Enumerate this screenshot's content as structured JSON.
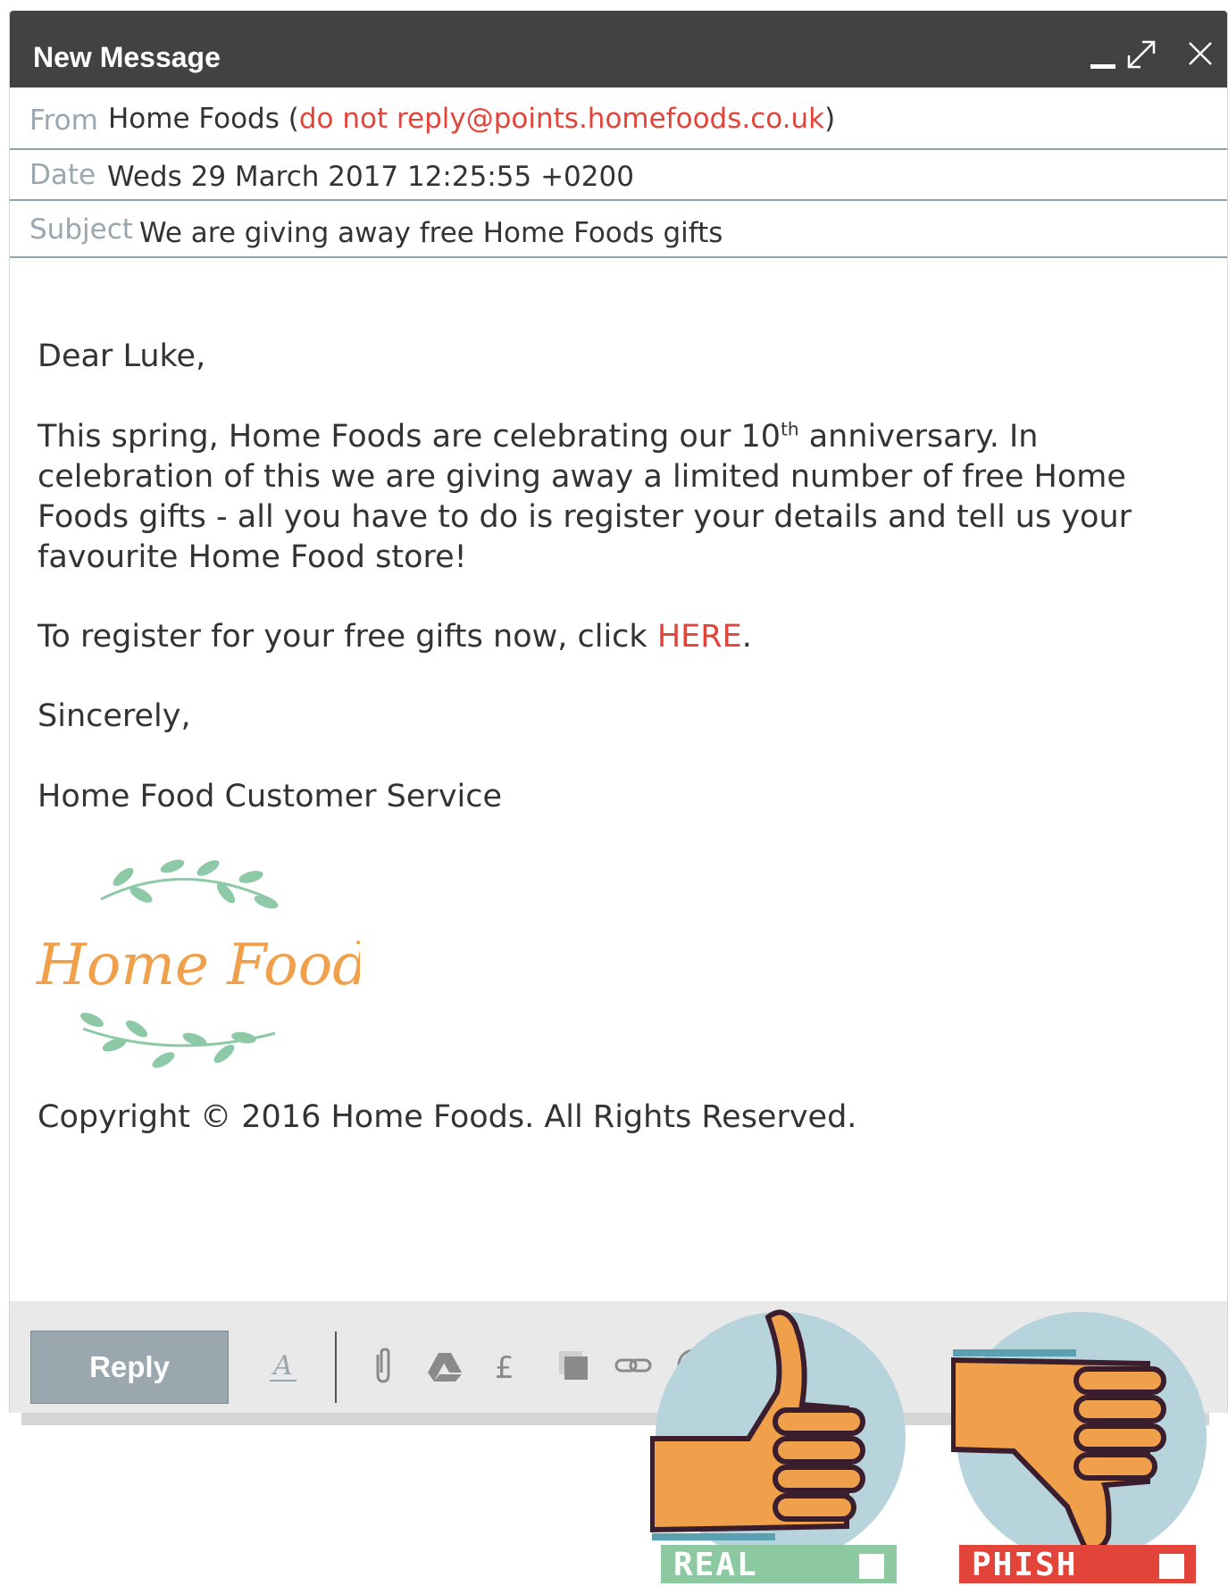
{
  "window": {
    "title": "New Message"
  },
  "header": {
    "from_label": "From",
    "from_name": "Home Foods (",
    "from_email": "do not reply@points.homefoods.co.uk",
    "from_close": ")",
    "date_label": "Date",
    "date_value": "Weds 29 March 2017 12:25:55 +0200",
    "subject_label": "Subject",
    "subject_value": "We are giving away free Home Foods gifts"
  },
  "body": {
    "greeting": "Dear Luke,",
    "p1_a": "This spring, Home Foods are celebrating our 10",
    "p1_sup": "th",
    "p1_b": " anniversary. In celebration of this we are giving away a limited number of free Home Foods gifts - all you have to do is register your details and tell us your favourite Home Food store!",
    "p2_a": "To register for your free gifts now, click ",
    "p2_link": "HERE",
    "p2_b": ".",
    "closing": "Sincerely,",
    "signature": "Home Food Customer Service",
    "logo_text": "Home Foods",
    "copyright": "Copyright © 2016 Home Foods. All Rights Reserved."
  },
  "toolbar": {
    "reply_label": "Reply",
    "format_icon": "text-format-icon",
    "icons": [
      "paperclip-icon",
      "drive-icon",
      "pound-icon",
      "copy-icon",
      "link-icon",
      "emoji-icon"
    ]
  },
  "verdict": {
    "real_label": "REAL",
    "phish_label": "PHISH",
    "real_color": "#8cc9a0",
    "phish_color": "#e2443a"
  },
  "colors": {
    "titlebar": "#424242",
    "accent_red": "#e2443a",
    "logo_orange": "#f0a04b",
    "leaf_green": "#8dc9a6",
    "thumb_circle": "#b7d3db",
    "thumb_skin": "#f0a04b"
  }
}
